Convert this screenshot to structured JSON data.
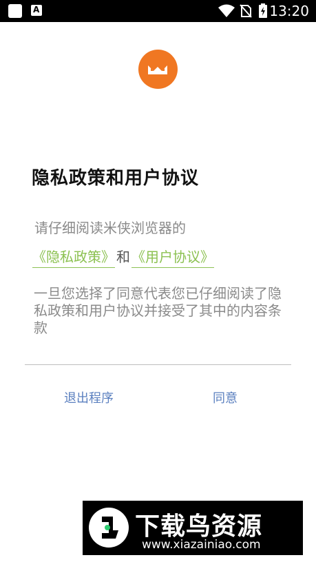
{
  "status_bar": {
    "time": "13:20",
    "icons": [
      "app-notification-icon",
      "a-notification-icon",
      "wifi-icon",
      "no-sim-icon",
      "battery-charging-icon"
    ]
  },
  "dialog": {
    "logo_icon": "app-logo-icon",
    "title": "隐私政策和用户协议",
    "intro": "请仔细阅读米侠浏览器的",
    "privacy_link": "《隐私政策》",
    "and": "和",
    "user_agreement_link": "《用户协议》",
    "consent": "一旦您选择了同意代表您已仔细阅读了隐私政策和用户协议并接受了其中的内容条款",
    "exit_button": "退出程序",
    "agree_button": "同意"
  },
  "watermark": {
    "title": "下载鸟资源",
    "url": "www.xiazainiao.com"
  },
  "colors": {
    "link": "#8cc152",
    "button": "#5a7fbf",
    "logo_bg": "#f07722"
  }
}
